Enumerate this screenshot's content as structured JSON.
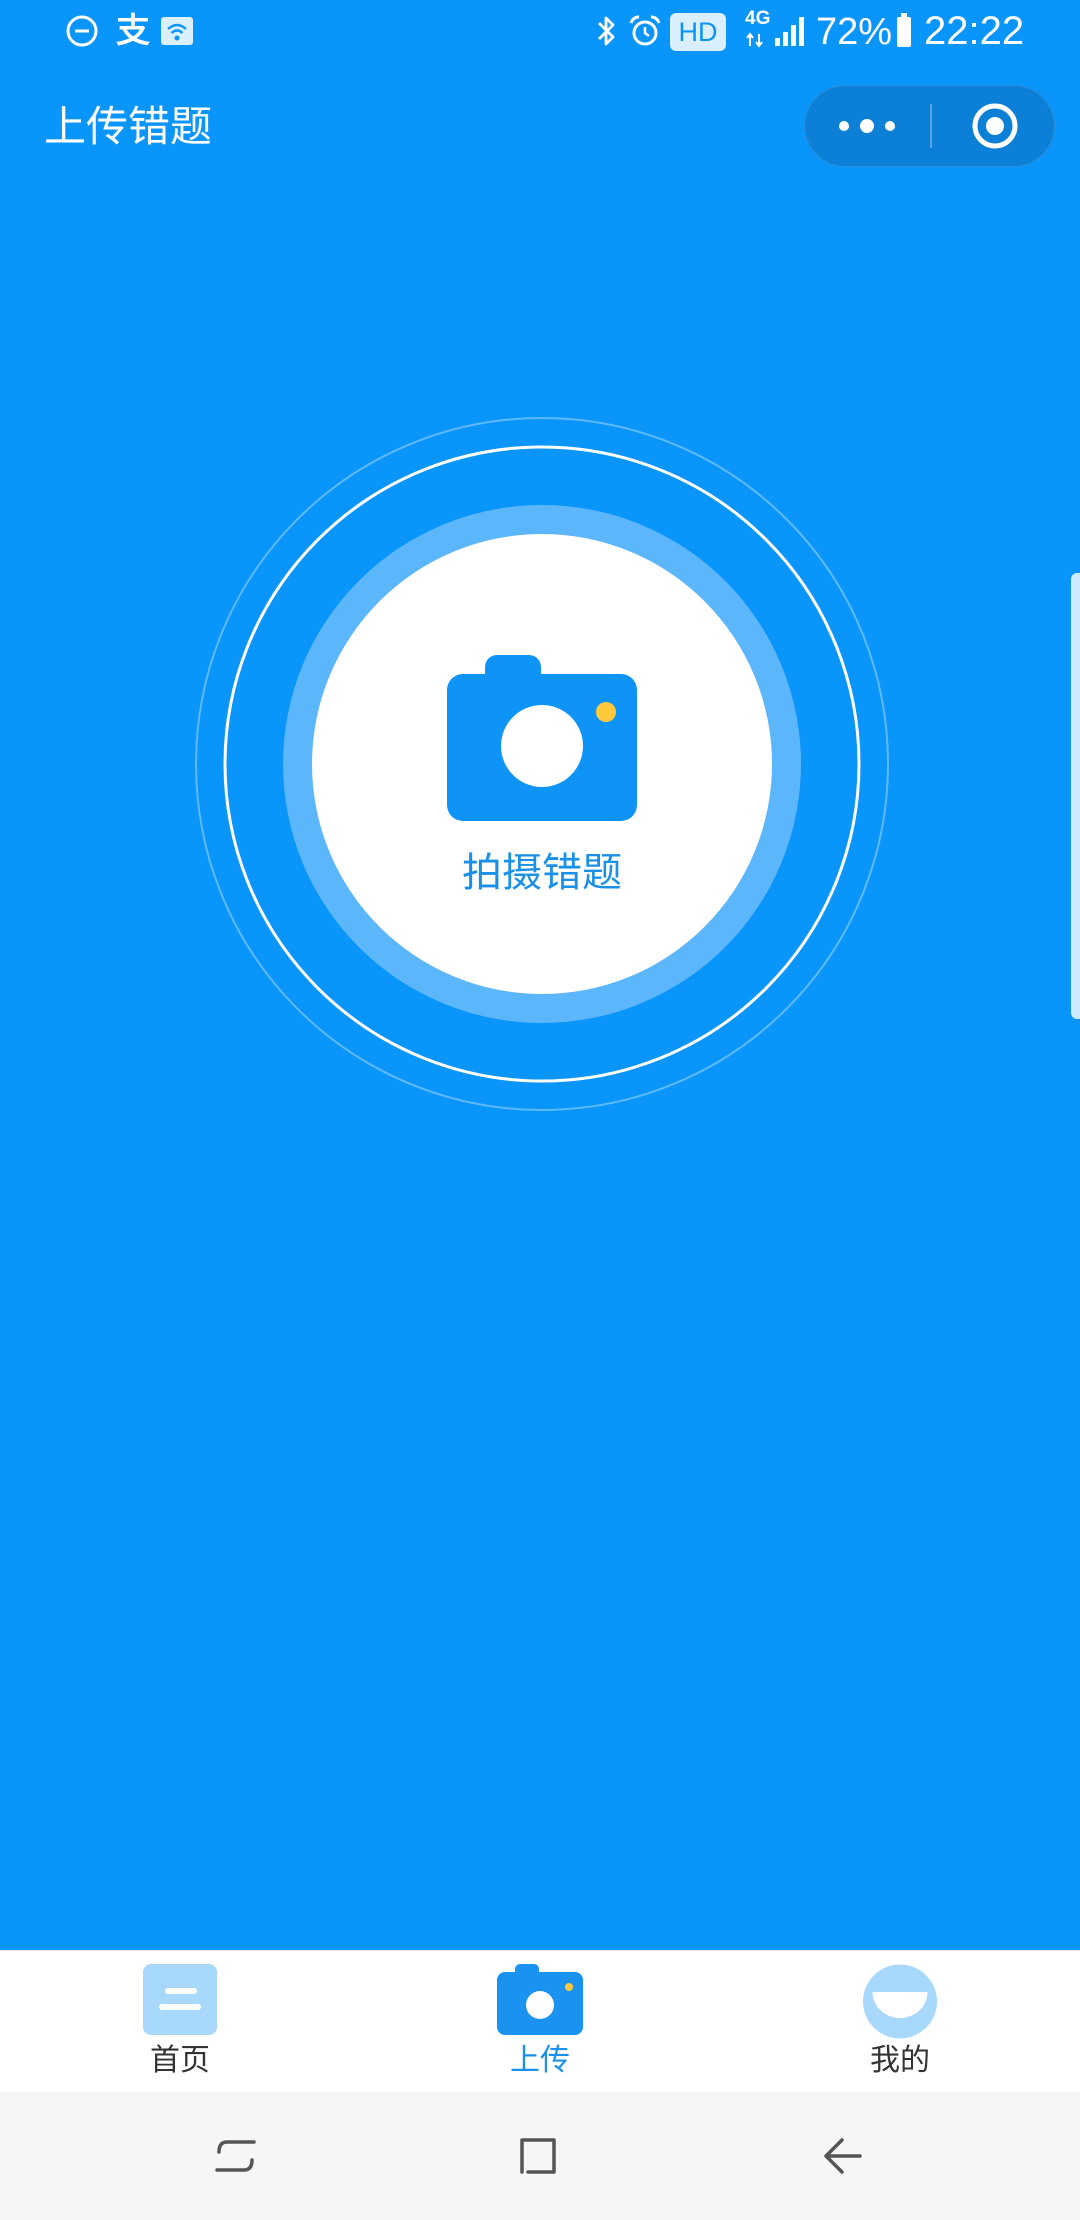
{
  "status_bar": {
    "left_icons": [
      "do-not-disturb-icon",
      "alipay-icon",
      "wifi-icon"
    ],
    "alipay_glyph": "支",
    "right_icons": [
      "bluetooth-icon",
      "alarm-icon",
      "signal-icon",
      "battery-icon"
    ],
    "hd_badge": "HD",
    "network_type": "4G",
    "battery_percent": "72%",
    "time": "22:22"
  },
  "header": {
    "title": "上传错题",
    "capsule": {
      "more_icon": "more-dots-icon",
      "close_icon": "target-icon"
    }
  },
  "main": {
    "capture_button": {
      "icon": "camera-icon",
      "label": "拍摄错题"
    }
  },
  "tab_bar": {
    "items": [
      {
        "label": "首页",
        "icon": "home-icon",
        "active": false
      },
      {
        "label": "上传",
        "icon": "camera-icon",
        "active": true
      },
      {
        "label": "我的",
        "icon": "profile-icon",
        "active": false
      }
    ]
  },
  "nav_bar": {
    "icons": [
      "recent-apps-icon",
      "home-square-icon",
      "back-arrow-icon"
    ]
  },
  "colors": {
    "background": "#0995fa",
    "accent": "#1a90e8",
    "ring_band": "#5cb6fb",
    "tab_icon_light": "#a8d9fd",
    "camera_dot": "#ffc83d",
    "nav_bar": "#f6f6f6"
  }
}
